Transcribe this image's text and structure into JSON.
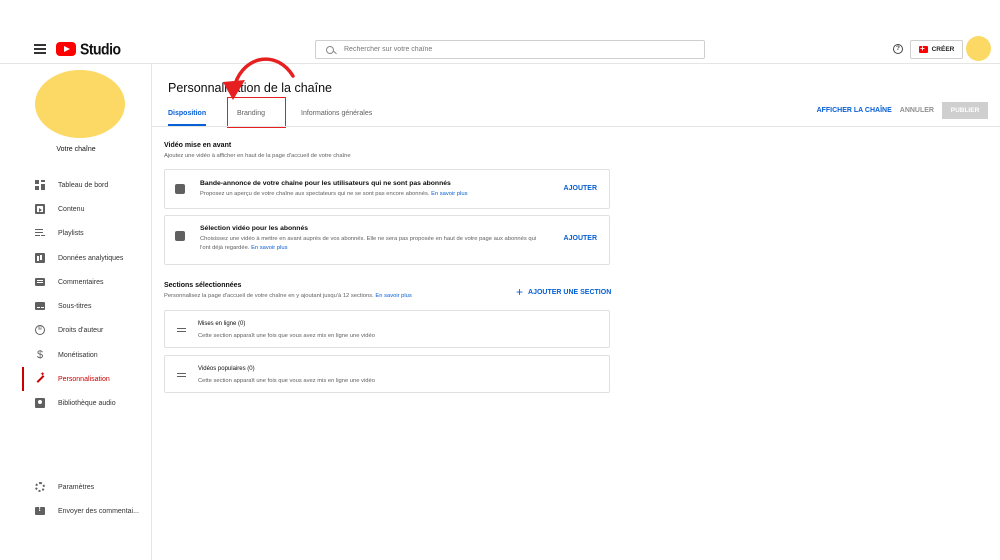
{
  "header": {
    "logo_text": "Studio",
    "search_placeholder": "Rechercher sur votre chaîne",
    "help_glyph": "?",
    "create_label": "CRÉER"
  },
  "sidebar": {
    "channel_name": "Votre chaîne",
    "items": [
      {
        "label": "Tableau de bord",
        "icon": "dashboard-icon"
      },
      {
        "label": "Contenu",
        "icon": "content-icon"
      },
      {
        "label": "Playlists",
        "icon": "playlist-icon"
      },
      {
        "label": "Données analytiques",
        "icon": "analytics-icon"
      },
      {
        "label": "Commentaires",
        "icon": "comments-icon"
      },
      {
        "label": "Sous-titres",
        "icon": "subtitles-icon"
      },
      {
        "label": "Droits d'auteur",
        "icon": "copyright-icon"
      },
      {
        "label": "Monétisation",
        "icon": "dollar-icon"
      },
      {
        "label": "Personnalisation",
        "icon": "magic-wand-icon",
        "active": true
      },
      {
        "label": "Bibliothèque audio",
        "icon": "audio-library-icon"
      }
    ],
    "bottom_items": [
      {
        "label": "Paramètres",
        "icon": "gear-icon"
      },
      {
        "label": "Envoyer des commentai...",
        "icon": "feedback-icon"
      }
    ],
    "copyright_glyph": "©",
    "dollar_glyph": "$"
  },
  "main": {
    "page_title": "Personnalisation de la chaîne",
    "tabs": [
      {
        "label": "Disposition",
        "active": true
      },
      {
        "label": "Branding"
      },
      {
        "label": "Informations générales"
      }
    ],
    "actions": {
      "view_channel": "AFFICHER LA CHAÎNE",
      "cancel": "ANNULER",
      "publish": "PUBLIER"
    },
    "featured": {
      "title": "Vidéo mise en avant",
      "desc": "Ajoutez une vidéo à afficher en haut de la page d'accueil de votre chaîne",
      "cards": [
        {
          "title": "Bande-annonce de votre chaîne pour les utilisateurs qui ne sont pas abonnés",
          "desc": "Proposez un aperçu de votre chaîne aux spectateurs qui ne se sont pas encore abonnés.",
          "link": "En savoir plus",
          "action": "AJOUTER"
        },
        {
          "title": "Sélection vidéo pour les abonnés",
          "desc": "Choisissez une vidéo à mettre en avant auprès de vos abonnés. Elle ne sera pas proposée en haut de votre page aux abonnés qui l'ont déjà regardée.",
          "link": "En savoir plus",
          "action": "AJOUTER"
        }
      ]
    },
    "sections": {
      "title": "Sections sélectionnées",
      "desc": "Personnalisez la page d'accueil de votre chaîne en y ajoutant jusqu'à 12 sections.",
      "link": "En savoir plus",
      "add_label": "AJOUTER UNE SECTION",
      "plus_glyph": "+",
      "items": [
        {
          "title": "Mises en ligne (0)",
          "desc": "Cette section apparaît une fois que vous avez mis en ligne une vidéo"
        },
        {
          "title": "Vidéos populaires (0)",
          "desc": "Cette section apparaît une fois que vous avez mis en ligne une vidéo"
        }
      ]
    }
  },
  "colors": {
    "accent": "#065fd4",
    "brand_red": "#ff0000",
    "active_red": "#cc0000",
    "avatar": "#fcd964",
    "highlight_annotation": "#e62020"
  }
}
